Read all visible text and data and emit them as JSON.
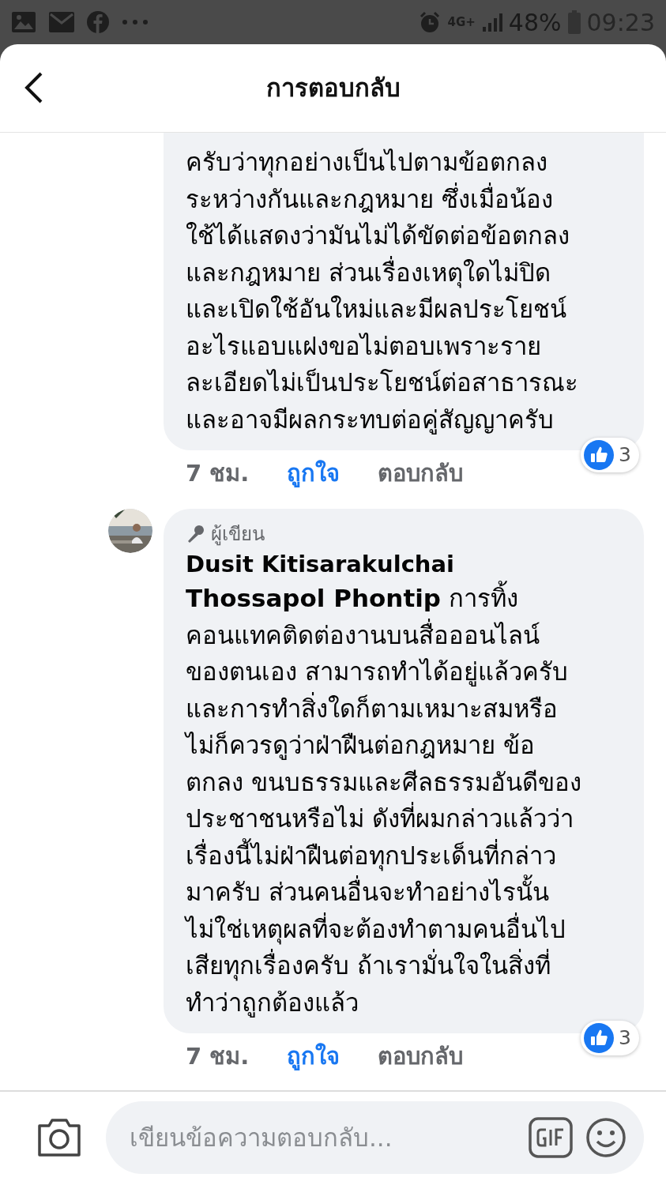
{
  "status_bar": {
    "battery": "48%",
    "time": "09:23",
    "network": "4G+"
  },
  "header": {
    "title": "การตอบกลับ"
  },
  "comments": [
    {
      "kind": "reply",
      "text": "ครับว่าทุกอย่างเป็นไปตามข้อตกลง\nระหว่างกันและกฎหมาย ซึ่งเมื่อน้อง\nใช้ได้แสดงว่ามันไม่ได้ขัดต่อข้อตกลง\nและกฎหมาย ส่วนเรื่องเหตุใดไม่ปิด\nและเปิดใช้อันใหม่และมีผลประโยชน์\nอะไรแอบแฝงขอไม่ตอบเพราะราย\nละเอียดไม่เป็นประโยชน์ต่อสาธารณะ\nและอาจมีผลกระทบต่อคู่สัญญาครับ",
      "time": "7 ชม.",
      "like": "ถูกใจ",
      "liked": true,
      "reply": "ตอบกลับ",
      "reactions": "3"
    },
    {
      "kind": "author",
      "author_badge": "ผู้เขียน",
      "author": "Dusit Kitisarakulchai",
      "text": "**Thossapol Phontip** การทิ้ง\nคอนแทคติดต่องานบนสื่อออนไลน์\nของตนเอง สามารถทำได้อยู่แล้วครับ\nและการทำสิ่งใดก็ตามเหมาะสมหรือ\nไม่ก็ควรดูว่าฝ่าฝืนต่อกฎหมาย ข้อ\nตกลง ขนบธรรมและศีลธรรมอันดีของ\nประชาชนหรือไม่ ดังที่ผมกล่าวแล้วว่า\nเรื่องนี้ไม่ฝ่าฝืนต่อทุกประเด็นที่กล่าว\nมาครับ ส่วนคนอื่นจะทำอย่างไรนั้น\nไม่ใช่เหตุผลที่จะต้องทำตามคนอื่นไป\nเสียทุกเรื่องครับ ถ้าเรามั่นใจในสิ่งที่\nทำว่าถูกต้องแล้ว",
      "time": "7 ชม.",
      "like": "ถูกใจ",
      "liked": true,
      "reply": "ตอบกลับ",
      "reactions": "3"
    }
  ],
  "composer": {
    "placeholder": "เขียนข้อความตอบกลับ..."
  }
}
